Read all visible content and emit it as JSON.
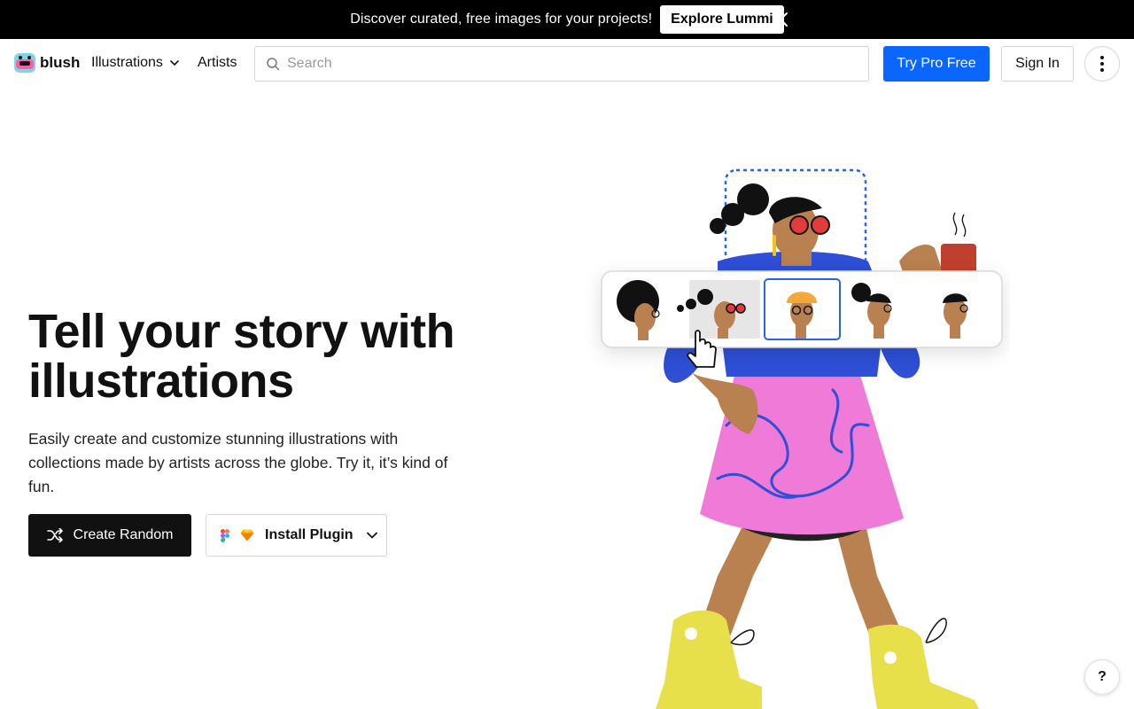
{
  "promo": {
    "text": "Discover curated, free images for your projects!",
    "button_label": "Explore Lummi",
    "close_icon": "close-icon"
  },
  "header": {
    "logo_text": "blush",
    "nav": {
      "illustrations_label": "Illustrations",
      "artists_label": "Artists"
    },
    "search": {
      "placeholder": "Search",
      "value": ""
    },
    "try_pro_label": "Try Pro Free",
    "sign_in_label": "Sign In"
  },
  "hero": {
    "title": "Tell your story with illustrations",
    "subtitle": "Easily create and customize stunning illustrations with collections made by artists across the globe. Try it, it’s kind of fun.",
    "create_random_label": "Create Random",
    "install_plugin_label": "Install Plugin"
  },
  "help": {
    "label": "?"
  },
  "colors": {
    "accent_blue": "#0a66ff",
    "dark": "#111111",
    "illustration_blue": "#2e4fd6",
    "illustration_pink": "#f07ad8",
    "illustration_skin": "#b9814f",
    "illustration_yellow": "#e8e04a"
  }
}
